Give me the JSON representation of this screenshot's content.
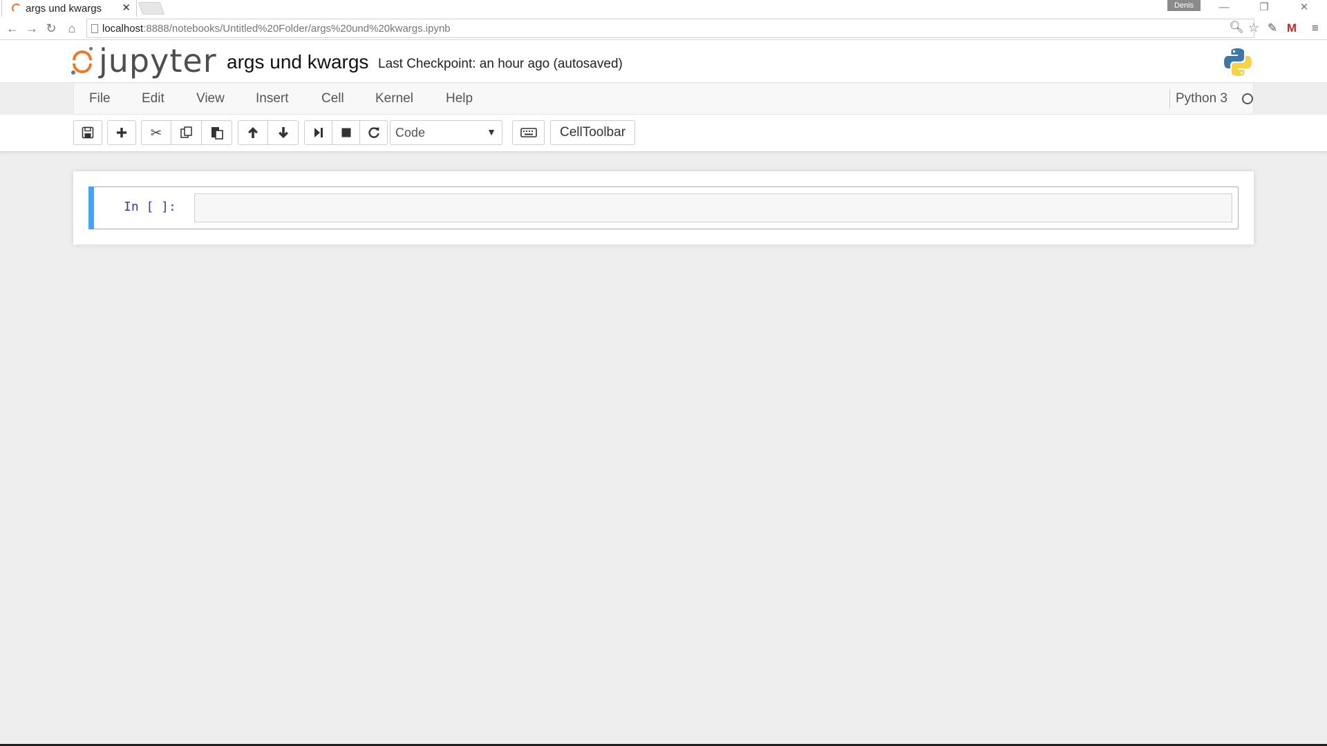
{
  "browser": {
    "tab_title": "args und kwargs",
    "tab_close": "✕",
    "user_badge": "Denis",
    "url_host": "localhost",
    "url_path": ":8888/notebooks/Untitled%20Folder/args%20und%20kwargs.ipynb",
    "window_buttons": {
      "minimize": "—",
      "restore": "❐",
      "close": "✕"
    },
    "nav": {
      "back": "←",
      "forward": "→",
      "reload": "↻",
      "home": "⌂"
    }
  },
  "header": {
    "logo_text": "jupyter",
    "notebook_title": "args und kwargs",
    "checkpoint_text": "Last Checkpoint: an hour ago (autosaved)"
  },
  "menubar": {
    "items": [
      "File",
      "Edit",
      "View",
      "Insert",
      "Cell",
      "Kernel",
      "Help"
    ],
    "kernel_name": "Python 3"
  },
  "toolbar": {
    "cell_type_selected": "Code",
    "celltoolbar_label": "CellToolbar",
    "icons": [
      "save-icon",
      "plus-icon",
      "cut-icon",
      "copy-icon",
      "paste-icon",
      "arrow-up-icon",
      "arrow-down-icon",
      "run-icon",
      "stop-icon",
      "restart-icon",
      "keyboard-icon"
    ]
  },
  "cells": [
    {
      "prompt": "In [ ]:",
      "source": ""
    }
  ],
  "colors": {
    "jupyter_orange": "#f37626",
    "cell_selected_bar": "#42a5f5",
    "prompt_blue": "#303f9f"
  }
}
